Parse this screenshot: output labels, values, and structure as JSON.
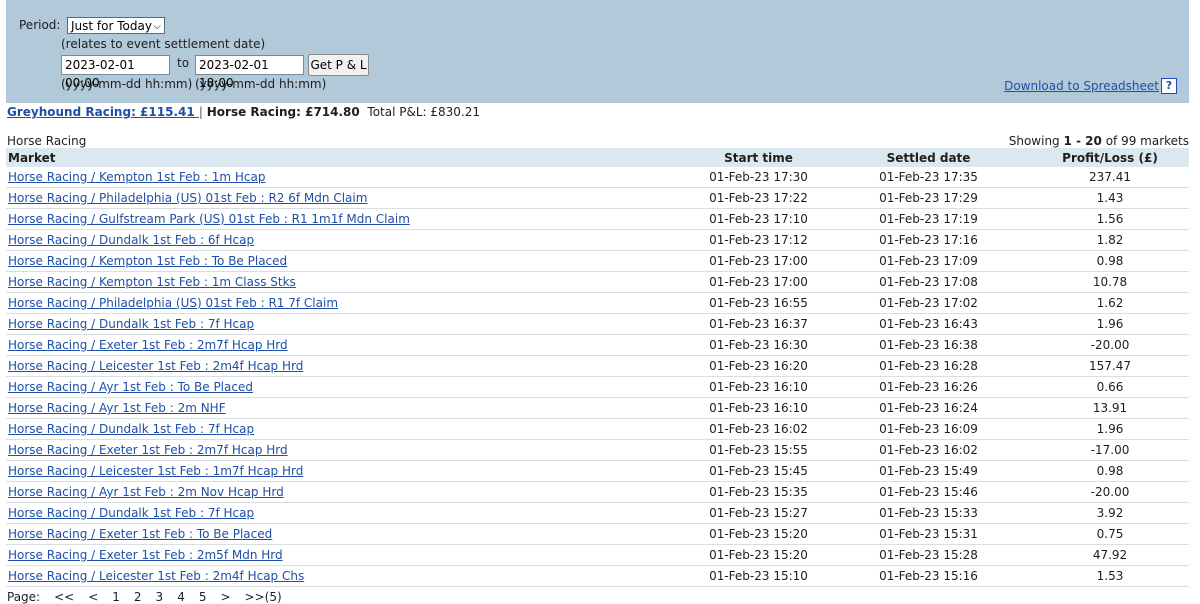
{
  "filter": {
    "period_label": "Period:",
    "period_value": "Just for Today",
    "period_note": "(relates to event settlement date)",
    "from_value": "2023-02-01 00:00",
    "to_label": "to",
    "to_value": "2023-02-01 18:00",
    "get_button": "Get P & L",
    "from_hint": "(yyyy-mm-dd hh:mm)",
    "to_hint": "(yyyy-mm-dd hh:mm)",
    "download_label": "Download to Spreadsheet",
    "help_label": "?"
  },
  "summary": {
    "greyhound_link": "Greyhound Racing: £115.41 ",
    "separator": "|",
    "horse_label": "Horse Racing: £714.80",
    "total_label": "Total P&L: £830.21"
  },
  "section": {
    "title": "Horse Racing",
    "showing_prefix": "Showing ",
    "showing_range": "1 - 20",
    "showing_suffix": " of 99 markets"
  },
  "table": {
    "headers": [
      "Market",
      "Start time",
      "Settled date",
      "Profit/Loss (£)"
    ],
    "rows": [
      {
        "market": "Horse Racing / Kempton 1st Feb : 1m Hcap",
        "start": "01-Feb-23 17:30",
        "settled": "01-Feb-23 17:35",
        "pl": "237.41"
      },
      {
        "market": "Horse Racing / Philadelphia (US) 01st Feb : R2 6f Mdn Claim",
        "start": "01-Feb-23 17:22",
        "settled": "01-Feb-23 17:29",
        "pl": "1.43"
      },
      {
        "market": "Horse Racing / Gulfstream Park (US) 01st Feb : R1 1m1f Mdn Claim",
        "start": "01-Feb-23 17:10",
        "settled": "01-Feb-23 17:19",
        "pl": "1.56"
      },
      {
        "market": "Horse Racing / Dundalk 1st Feb : 6f Hcap",
        "start": "01-Feb-23 17:12",
        "settled": "01-Feb-23 17:16",
        "pl": "1.82"
      },
      {
        "market": "Horse Racing / Kempton 1st Feb : To Be Placed",
        "start": "01-Feb-23 17:00",
        "settled": "01-Feb-23 17:09",
        "pl": "0.98"
      },
      {
        "market": "Horse Racing / Kempton 1st Feb : 1m Class Stks",
        "start": "01-Feb-23 17:00",
        "settled": "01-Feb-23 17:08",
        "pl": "10.78"
      },
      {
        "market": "Horse Racing / Philadelphia (US) 01st Feb : R1 7f Claim",
        "start": "01-Feb-23 16:55",
        "settled": "01-Feb-23 17:02",
        "pl": "1.62"
      },
      {
        "market": "Horse Racing / Dundalk 1st Feb : 7f Hcap",
        "start": "01-Feb-23 16:37",
        "settled": "01-Feb-23 16:43",
        "pl": "1.96"
      },
      {
        "market": "Horse Racing / Exeter 1st Feb : 2m7f Hcap Hrd",
        "start": "01-Feb-23 16:30",
        "settled": "01-Feb-23 16:38",
        "pl": "-20.00"
      },
      {
        "market": "Horse Racing / Leicester 1st Feb : 2m4f Hcap Hrd",
        "start": "01-Feb-23 16:20",
        "settled": "01-Feb-23 16:28",
        "pl": "157.47"
      },
      {
        "market": "Horse Racing / Ayr 1st Feb : To Be Placed",
        "start": "01-Feb-23 16:10",
        "settled": "01-Feb-23 16:26",
        "pl": "0.66"
      },
      {
        "market": "Horse Racing / Ayr 1st Feb : 2m NHF",
        "start": "01-Feb-23 16:10",
        "settled": "01-Feb-23 16:24",
        "pl": "13.91"
      },
      {
        "market": "Horse Racing / Dundalk 1st Feb : 7f Hcap",
        "start": "01-Feb-23 16:02",
        "settled": "01-Feb-23 16:09",
        "pl": "1.96"
      },
      {
        "market": "Horse Racing / Exeter 1st Feb : 2m7f Hcap Hrd",
        "start": "01-Feb-23 15:55",
        "settled": "01-Feb-23 16:02",
        "pl": "-17.00"
      },
      {
        "market": "Horse Racing / Leicester 1st Feb : 1m7f Hcap Hrd",
        "start": "01-Feb-23 15:45",
        "settled": "01-Feb-23 15:49",
        "pl": "0.98"
      },
      {
        "market": "Horse Racing / Ayr 1st Feb : 2m Nov Hcap Hrd",
        "start": "01-Feb-23 15:35",
        "settled": "01-Feb-23 15:46",
        "pl": "-20.00"
      },
      {
        "market": "Horse Racing / Dundalk 1st Feb : 7f Hcap",
        "start": "01-Feb-23 15:27",
        "settled": "01-Feb-23 15:33",
        "pl": "3.92"
      },
      {
        "market": "Horse Racing / Exeter 1st Feb : To Be Placed",
        "start": "01-Feb-23 15:20",
        "settled": "01-Feb-23 15:31",
        "pl": "0.75"
      },
      {
        "market": "Horse Racing / Exeter 1st Feb : 2m5f Mdn Hrd",
        "start": "01-Feb-23 15:20",
        "settled": "01-Feb-23 15:28",
        "pl": "47.92"
      },
      {
        "market": "Horse Racing / Leicester 1st Feb : 2m4f Hcap Chs",
        "start": "01-Feb-23 15:10",
        "settled": "01-Feb-23 15:16",
        "pl": "1.53"
      }
    ]
  },
  "pager": {
    "label": "Page:",
    "items": [
      "<<",
      "<",
      "1",
      "2",
      "3",
      "4",
      "5",
      ">",
      ">>(5)"
    ]
  }
}
